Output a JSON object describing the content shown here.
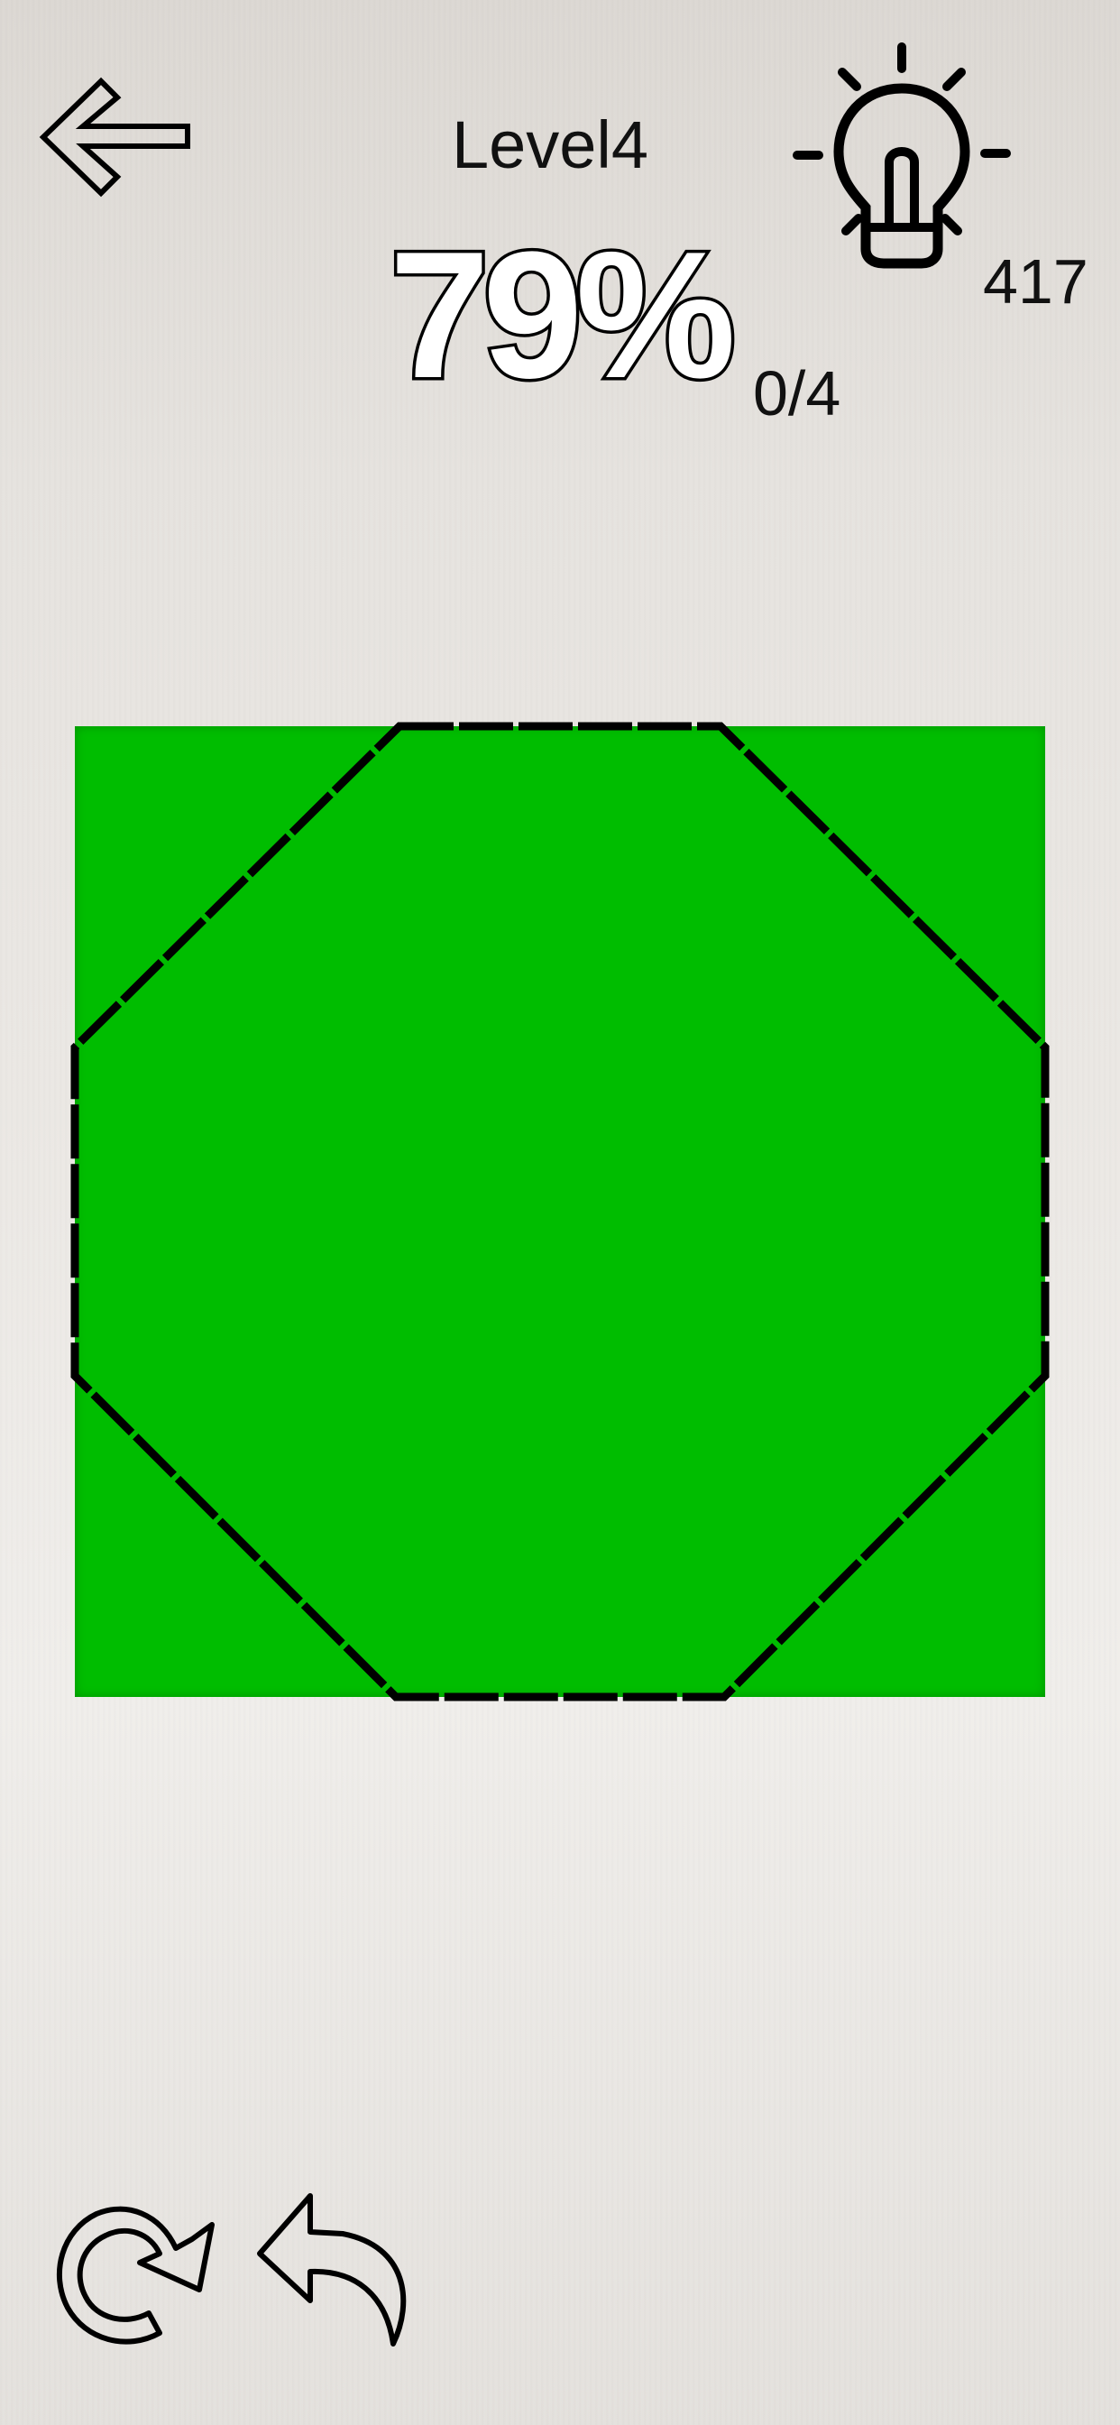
{
  "header": {
    "level_label": "Level4",
    "percent_label": "79%",
    "cuts_counter": "0/4",
    "hint_count": "417"
  },
  "icons": {
    "back": "arrow-left-icon",
    "hint": "lightbulb-icon",
    "redo": "redo-icon",
    "undo": "undo-icon"
  },
  "puzzle": {
    "shape": "square",
    "target_outline": "octagon",
    "fill_color": "#00bd00",
    "cut_line_color": "#000000"
  }
}
